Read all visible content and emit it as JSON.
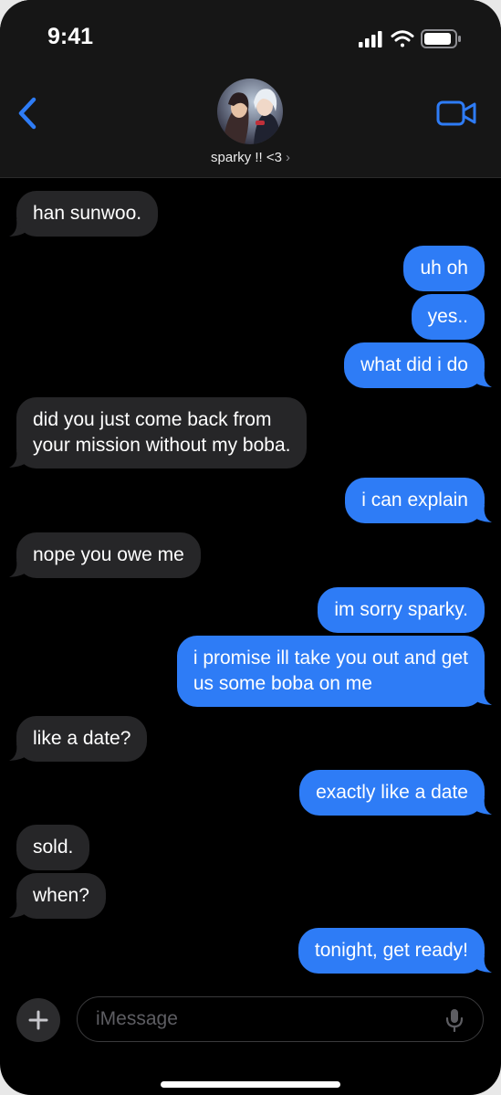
{
  "status_bar": {
    "time": "9:41",
    "icons": [
      "cellular-signal-icon",
      "wifi-icon",
      "battery-icon"
    ]
  },
  "header": {
    "back_icon": "chevron-left-icon",
    "video_icon": "video-camera-icon",
    "contact_name": "sparky !! <3",
    "contact_chevron": "›"
  },
  "messages": [
    {
      "side": "in",
      "text": "han sunwoo."
    },
    {
      "side": "out",
      "text": "uh oh"
    },
    {
      "side": "out",
      "text": "yes.."
    },
    {
      "side": "out",
      "text": "what did i do"
    },
    {
      "side": "in",
      "lines": [
        "did you just come back from",
        "your mission without my boba."
      ]
    },
    {
      "side": "out",
      "text": "i can explain"
    },
    {
      "side": "in",
      "text": "nope you owe me"
    },
    {
      "side": "out",
      "text": "im sorry sparky."
    },
    {
      "side": "out",
      "lines": [
        "i promise ill take you out and get",
        "us some boba on me"
      ]
    },
    {
      "side": "in",
      "text": "like a date?"
    },
    {
      "side": "out",
      "text": "exactly like a date"
    },
    {
      "side": "in",
      "text": "sold."
    },
    {
      "side": "in",
      "text": "when?"
    },
    {
      "side": "out",
      "text": "tonight, get ready!"
    }
  ],
  "composer": {
    "plus_label": "+",
    "placeholder": "iMessage",
    "mic_icon": "microphone-icon"
  },
  "colors": {
    "incoming_bubble": "#262628",
    "outgoing_bubble": "#2e7cf6",
    "accent": "#2e7cf6",
    "background": "#000000"
  }
}
